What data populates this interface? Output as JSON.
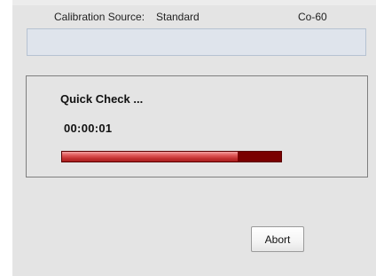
{
  "calibration": {
    "label": "Calibration Source:",
    "value": "Standard",
    "isotope": "Co-60"
  },
  "status_field": {
    "value": ""
  },
  "quick_check": {
    "title": "Quick Check ...",
    "elapsed": "00:00:01",
    "progress_fraction": 0.8
  },
  "buttons": {
    "abort_label": "Abort"
  },
  "colors": {
    "progress_fill": "#d04040",
    "progress_track": "#7a0000"
  }
}
